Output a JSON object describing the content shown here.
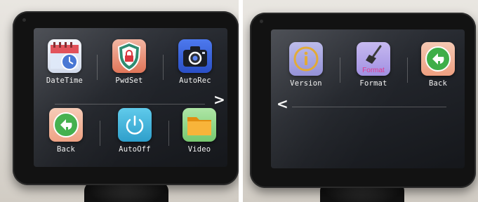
{
  "left_screen": {
    "items": [
      {
        "label": "DateTime",
        "icon": "calendar-clock-icon"
      },
      {
        "label": "PwdSet",
        "icon": "shield-lock-icon"
      },
      {
        "label": "AutoRec",
        "icon": "camera-icon"
      },
      {
        "label": "Back",
        "icon": "back-arrow-icon"
      },
      {
        "label": "AutoOff",
        "icon": "power-icon"
      },
      {
        "label": "Video",
        "icon": "folder-icon"
      }
    ],
    "next_arrow": ">"
  },
  "right_screen": {
    "items": [
      {
        "label": "Version",
        "icon": "info-icon"
      },
      {
        "label": "Format",
        "icon": "broom-format-icon",
        "icon_text": "Format"
      },
      {
        "label": "Back",
        "icon": "back-arrow-icon"
      }
    ],
    "prev_arrow": "<"
  },
  "colors": {
    "bezel": "#121212",
    "screen": "#22252b",
    "label": "#f2f2f2",
    "back_green": "#3fae49",
    "power_cyan": "#3fb6dc",
    "camera_blue": "#2f59d6",
    "folder_orange": "#f5a623",
    "format_pink": "#e0368e"
  }
}
